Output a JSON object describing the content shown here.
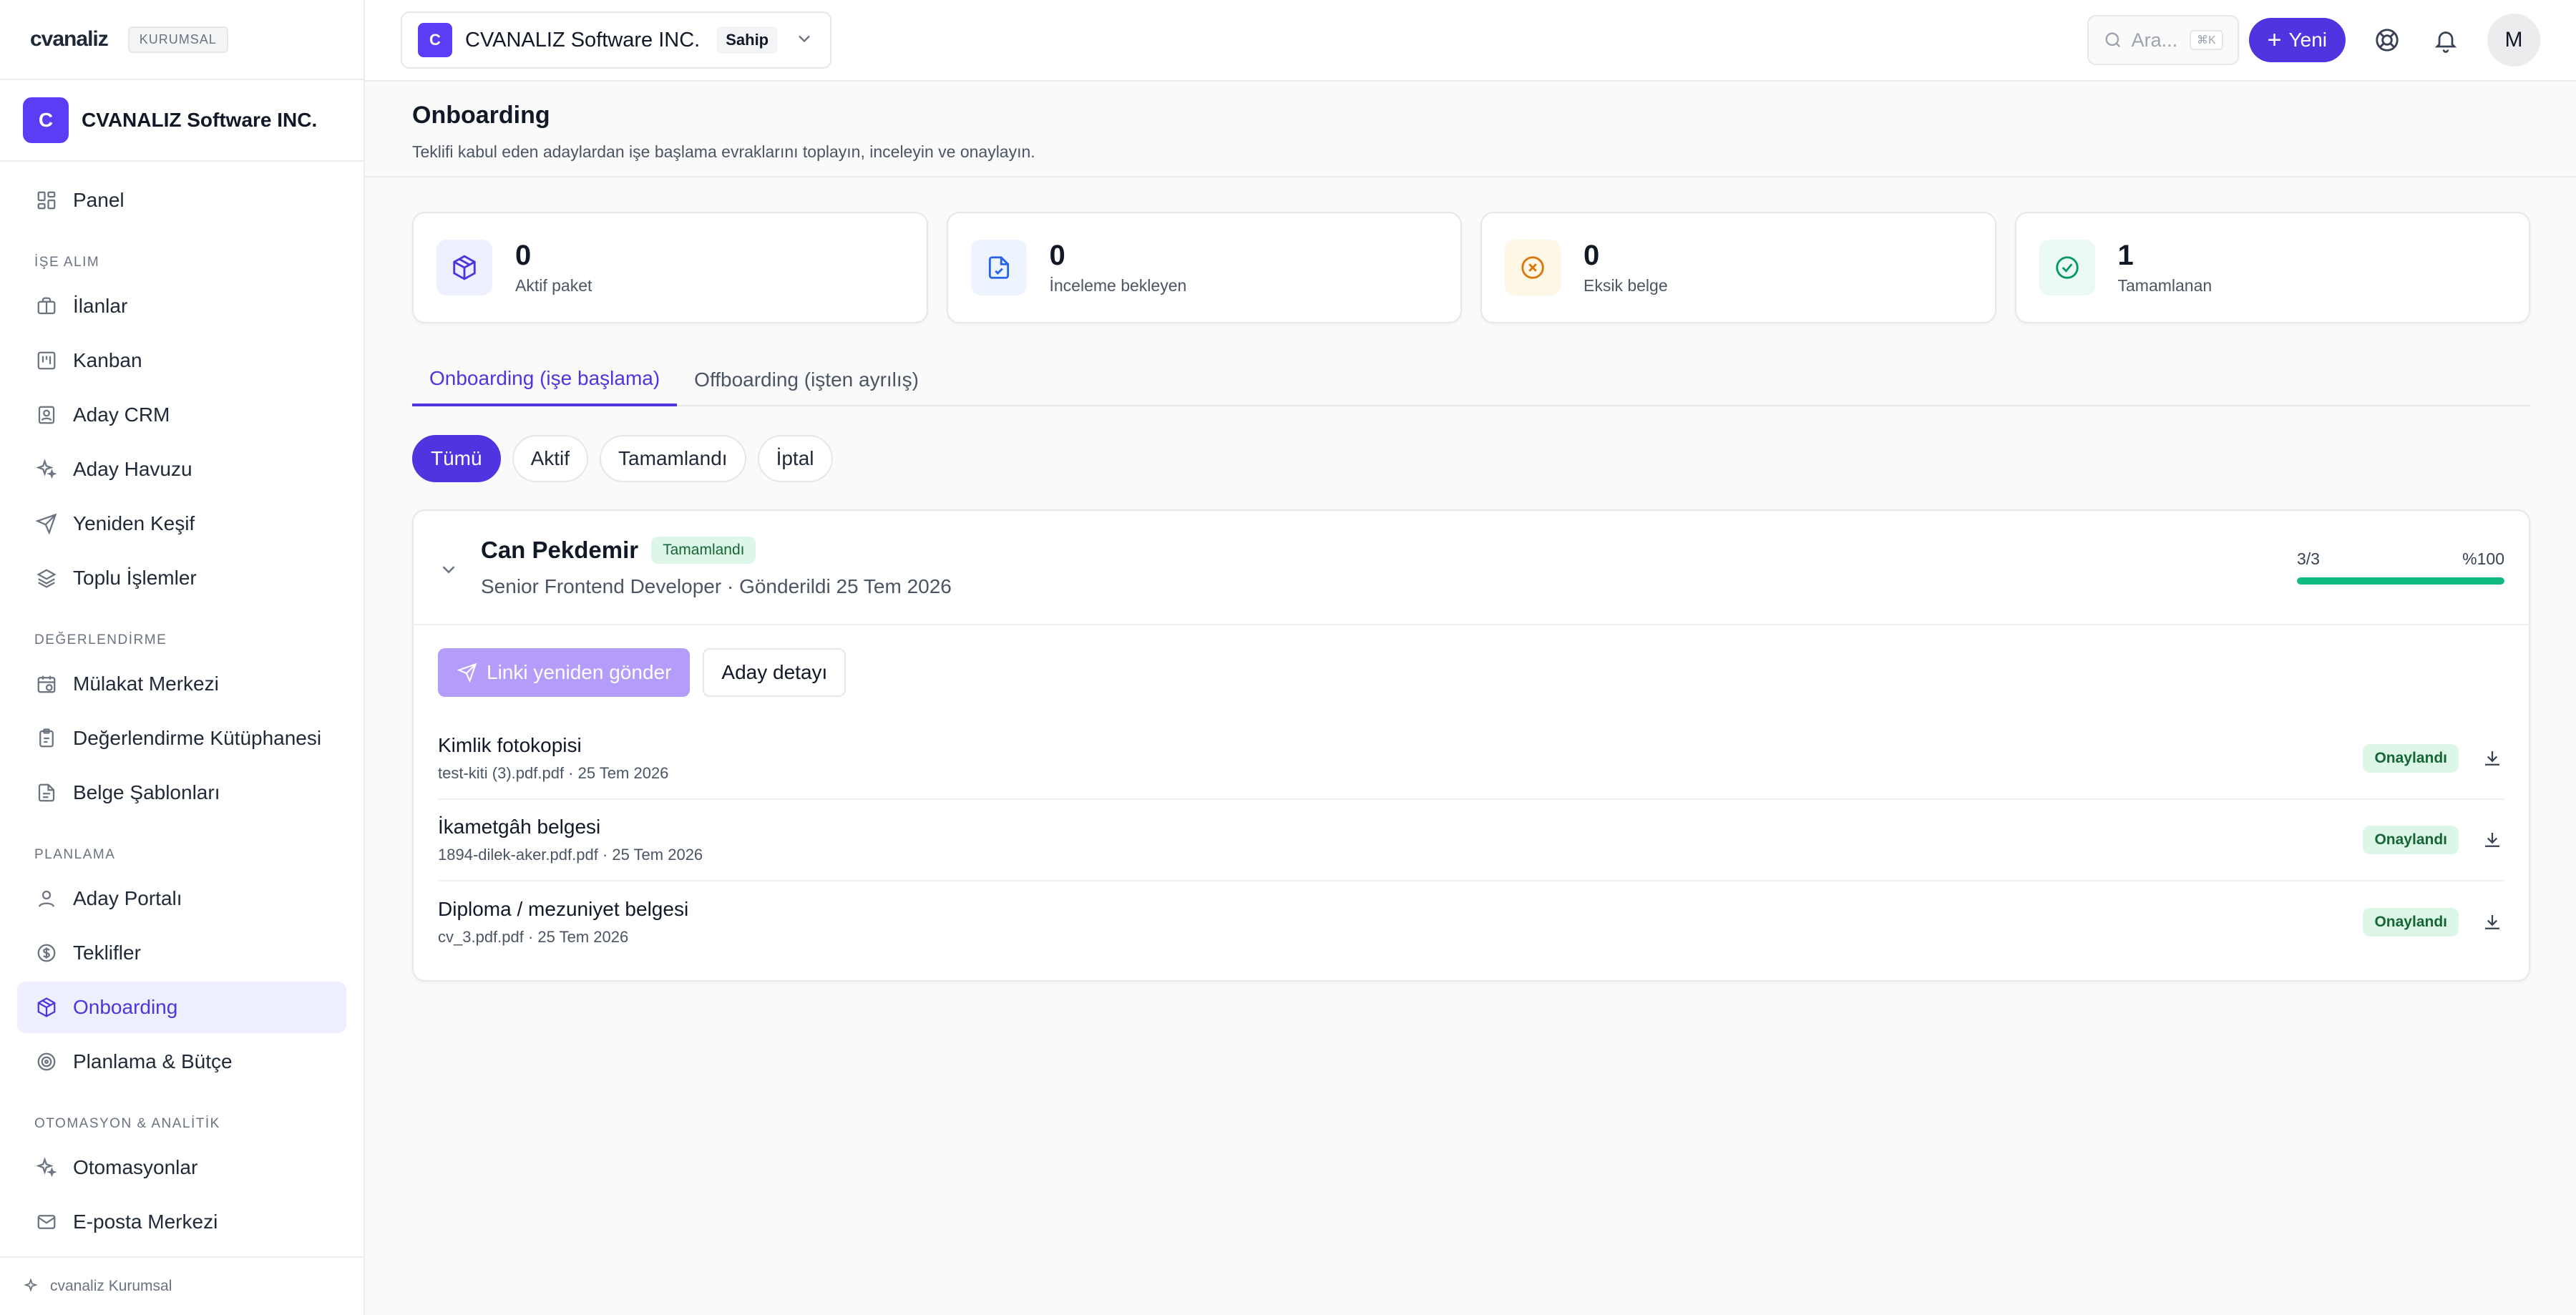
{
  "brand": {
    "logo": "cvanaliz",
    "badge": "KURUMSAL"
  },
  "org": {
    "initial": "C",
    "name": "CVANALIZ Software INC.",
    "role": "Sahip"
  },
  "sidebar": {
    "top_item": {
      "label": "Panel",
      "icon": "grid-icon"
    },
    "sections": [
      {
        "title": "İŞE ALIM",
        "items": [
          {
            "label": "İlanlar",
            "icon": "briefcase-icon"
          },
          {
            "label": "Kanban",
            "icon": "kanban-icon"
          },
          {
            "label": "Aday CRM",
            "icon": "contact-icon"
          },
          {
            "label": "Aday Havuzu",
            "icon": "sparkles-icon"
          },
          {
            "label": "Yeniden Keşif",
            "icon": "send-icon"
          },
          {
            "label": "Toplu İşlemler",
            "icon": "layers-icon"
          }
        ]
      },
      {
        "title": "DEĞERLENDİRME",
        "items": [
          {
            "label": "Mülakat Merkezi",
            "icon": "calendar-clock-icon"
          },
          {
            "label": "Değerlendirme Kütüphanesi",
            "icon": "clipboard-icon"
          },
          {
            "label": "Belge Şablonları",
            "icon": "file-icon"
          }
        ]
      },
      {
        "title": "PLANLAMA",
        "items": [
          {
            "label": "Aday Portalı",
            "icon": "user-icon"
          },
          {
            "label": "Teklifler",
            "icon": "dollar-circle-icon"
          },
          {
            "label": "Onboarding",
            "icon": "package-icon",
            "active": true
          },
          {
            "label": "Planlama & Bütçe",
            "icon": "target-icon"
          }
        ]
      },
      {
        "title": "OTOMASYON & ANALİTİK",
        "items": [
          {
            "label": "Otomasyonlar",
            "icon": "sparkles-icon"
          },
          {
            "label": "E-posta Merkezi",
            "icon": "mail-icon"
          }
        ]
      }
    ],
    "footer": "cvanaliz Kurumsal"
  },
  "topbar": {
    "search_placeholder": "Ara...",
    "search_shortcut": "⌘K",
    "new_label": "Yeni",
    "avatar_initial": "M"
  },
  "page": {
    "title": "Onboarding",
    "subtitle": "Teklifi kabul eden adaylardan işe başlama evraklarını toplayın, inceleyin ve onaylayın."
  },
  "stats": [
    {
      "value": "0",
      "label": "Aktif paket",
      "icon": "package-icon",
      "color": "#4f34e0",
      "bg": "#eef0ff"
    },
    {
      "value": "0",
      "label": "İnceleme bekleyen",
      "icon": "file-check-icon",
      "color": "#2563eb",
      "bg": "#eef4ff"
    },
    {
      "value": "0",
      "label": "Eksik belge",
      "icon": "x-circle-icon",
      "color": "#d97706",
      "bg": "#fff7e6"
    },
    {
      "value": "1",
      "label": "Tamamlanan",
      "icon": "check-circle-icon",
      "color": "#059669",
      "bg": "#eafaf2"
    }
  ],
  "tabs": [
    {
      "label": "Onboarding (işe başlama)",
      "active": true
    },
    {
      "label": "Offboarding (işten ayrılış)",
      "active": false
    }
  ],
  "filters": [
    {
      "label": "Tümü",
      "active": true
    },
    {
      "label": "Aktif",
      "active": false
    },
    {
      "label": "Tamamlandı",
      "active": false
    },
    {
      "label": "İptal",
      "active": false
    }
  ],
  "candidate": {
    "name": "Can Pekdemir",
    "status": "Tamamlandı",
    "subtitle": "Senior Frontend Developer · Gönderildi 25 Tem 2026",
    "progress_count": "3/3",
    "progress_percent_label": "%100",
    "progress": 1.0,
    "resend_label": "Linki yeniden gönder",
    "detail_label": "Aday detayı",
    "documents": [
      {
        "title": "Kimlik fotokopisi",
        "meta": "test-kiti (3).pdf.pdf · 25 Tem 2026",
        "status": "Onaylandı"
      },
      {
        "title": "İkametgâh belgesi",
        "meta": "1894-dilek-aker.pdf.pdf · 25 Tem 2026",
        "status": "Onaylandı"
      },
      {
        "title": "Diploma / mezuniyet belgesi",
        "meta": "cv_3.pdf.pdf · 25 Tem 2026",
        "status": "Onaylandı"
      }
    ]
  },
  "colors": {
    "accent": "#4f34e0",
    "success": "#10b981"
  }
}
